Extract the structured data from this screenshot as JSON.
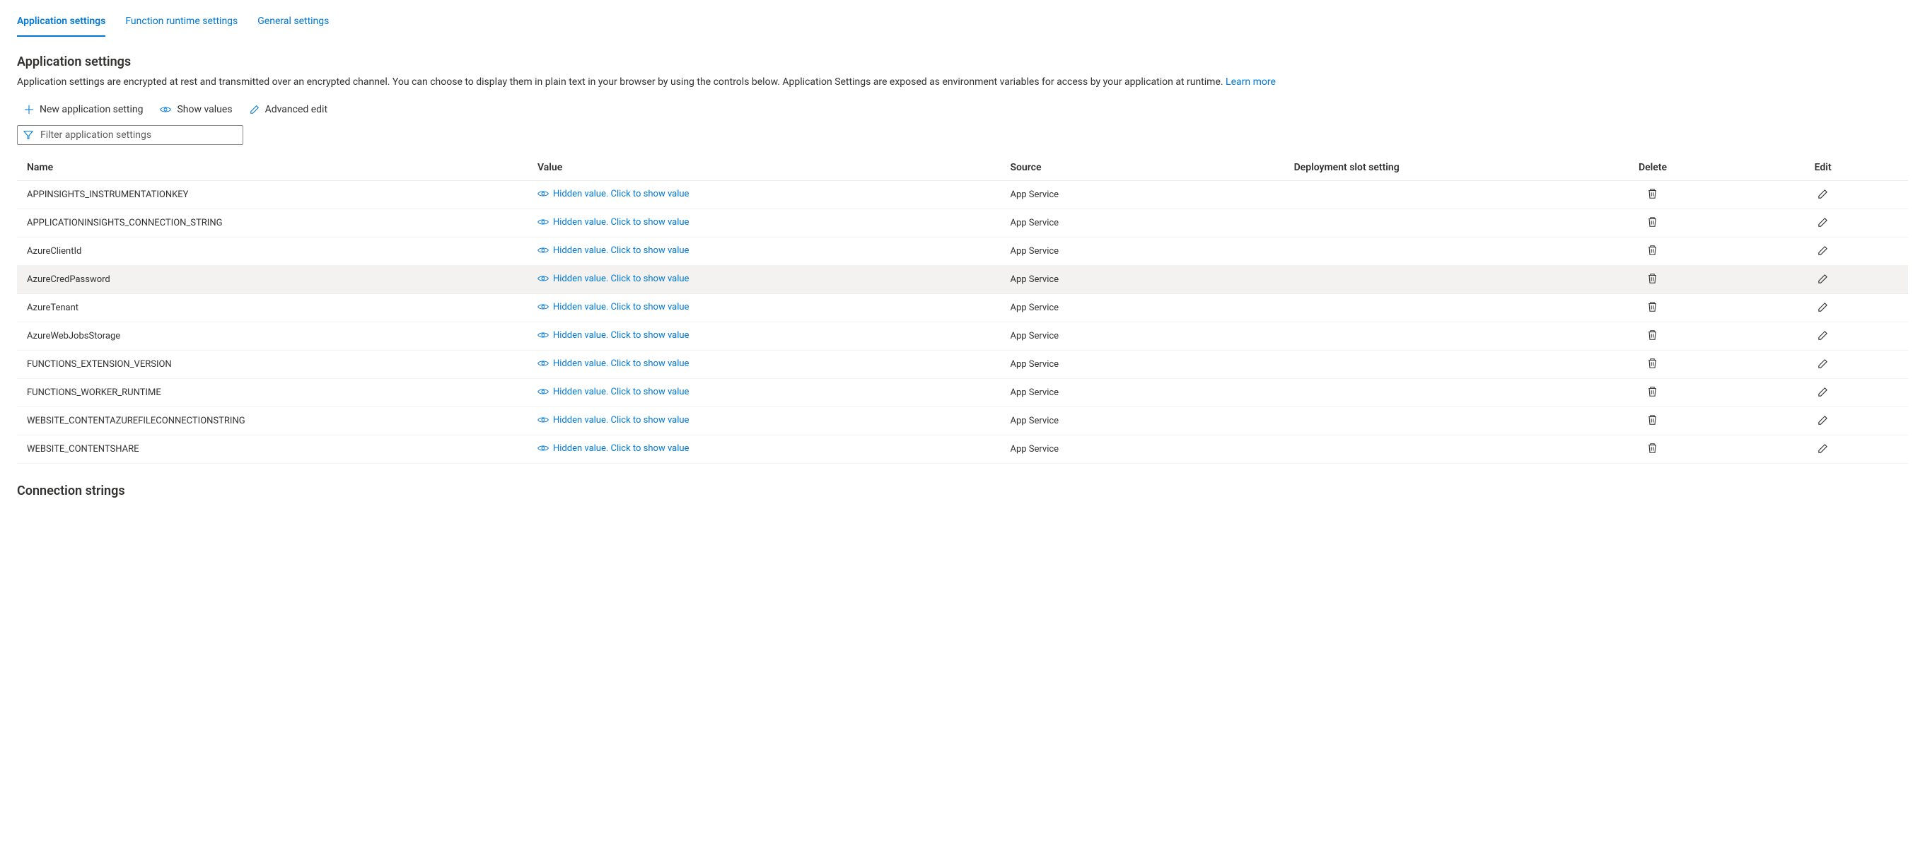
{
  "tabs": [
    {
      "label": "Application settings",
      "active": true
    },
    {
      "label": "Function runtime settings",
      "active": false
    },
    {
      "label": "General settings",
      "active": false
    }
  ],
  "section": {
    "heading": "Application settings",
    "description": "Application settings are encrypted at rest and transmitted over an encrypted channel. You can choose to display them in plain text in your browser by using the controls below. Application Settings are exposed as environment variables for access by your application at runtime. ",
    "learn_more": "Learn more"
  },
  "toolbar": {
    "new_setting": "New application setting",
    "show_values": "Show values",
    "advanced_edit": "Advanced edit"
  },
  "filter": {
    "placeholder": "Filter application settings"
  },
  "columns": {
    "name": "Name",
    "value": "Value",
    "source": "Source",
    "slot": "Deployment slot setting",
    "delete": "Delete",
    "edit": "Edit"
  },
  "hidden_value_text": "Hidden value. Click to show value",
  "rows": [
    {
      "name": "APPINSIGHTS_INSTRUMENTATIONKEY",
      "source": "App Service",
      "slot": "",
      "highlighted": false
    },
    {
      "name": "APPLICATIONINSIGHTS_CONNECTION_STRING",
      "source": "App Service",
      "slot": "",
      "highlighted": false
    },
    {
      "name": "AzureClientId",
      "source": "App Service",
      "slot": "",
      "highlighted": false
    },
    {
      "name": "AzureCredPassword",
      "source": "App Service",
      "slot": "",
      "highlighted": true
    },
    {
      "name": "AzureTenant",
      "source": "App Service",
      "slot": "",
      "highlighted": false
    },
    {
      "name": "AzureWebJobsStorage",
      "source": "App Service",
      "slot": "",
      "highlighted": false
    },
    {
      "name": "FUNCTIONS_EXTENSION_VERSION",
      "source": "App Service",
      "slot": "",
      "highlighted": false
    },
    {
      "name": "FUNCTIONS_WORKER_RUNTIME",
      "source": "App Service",
      "slot": "",
      "highlighted": false
    },
    {
      "name": "WEBSITE_CONTENTAZUREFILECONNECTIONSTRING",
      "source": "App Service",
      "slot": "",
      "highlighted": false
    },
    {
      "name": "WEBSITE_CONTENTSHARE",
      "source": "App Service",
      "slot": "",
      "highlighted": false
    }
  ],
  "connection_strings_heading": "Connection strings"
}
